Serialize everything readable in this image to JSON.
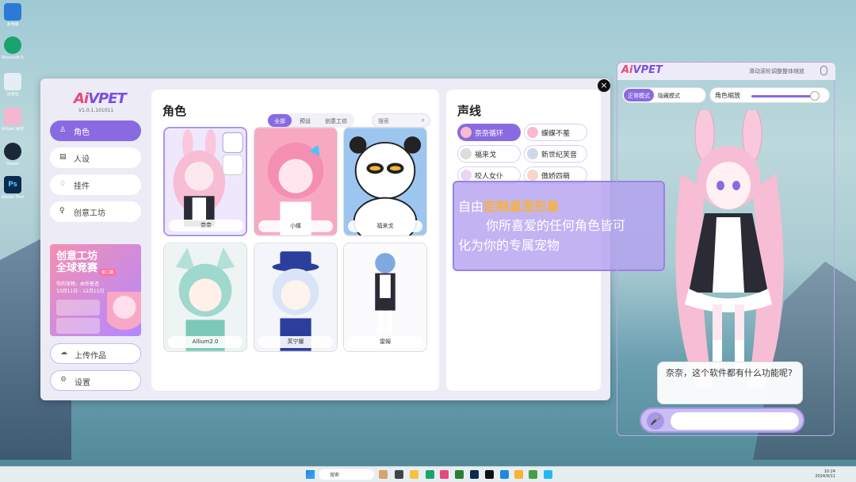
{
  "desktop": {
    "icons": [
      {
        "label": "此电脑",
        "color": "#2b7bd6"
      },
      {
        "label": "Microsoft Edge",
        "color": "#1aa36f"
      },
      {
        "label": "回收站",
        "color": "#e5eef5"
      },
      {
        "label": "AiVpet 桌宠",
        "color": "#f3b7cf"
      },
      {
        "label": "Steam",
        "color": "#1b2838"
      },
      {
        "label": "Adobe Photoshop",
        "color": "#0b2a4e"
      }
    ]
  },
  "taskbar": {
    "search_placeholder": "搜索",
    "time": "10:24",
    "date": "2024/9/11"
  },
  "main_window": {
    "logo_ai": "Ai",
    "logo_rest": "VPET",
    "version": "V1.0.1.101011",
    "close_label": "×",
    "nav": [
      {
        "label": "角色",
        "icon": "shirt-icon",
        "glyph": "♙"
      },
      {
        "label": "人设",
        "icon": "document-icon",
        "glyph": "▤"
      },
      {
        "label": "挂件",
        "icon": "gift-icon",
        "glyph": "♢"
      },
      {
        "label": "创意工坊",
        "icon": "bulb-icon",
        "glyph": "♀"
      }
    ],
    "promo": {
      "title_line1": "创意工坊",
      "title_line2": "全球竞赛",
      "tag": "第二期",
      "line1": "你的宠物，由你普造",
      "line2": "10月11日 - 12月11日"
    },
    "upload_label": "上传作品",
    "settings_label": "设置",
    "characters": {
      "title": "角色",
      "filters": [
        "全部",
        "预设",
        "创意工坊"
      ],
      "search_placeholder": "搜索",
      "cards": [
        {
          "name": "奈奈"
        },
        {
          "name": "小蝶"
        },
        {
          "name": "福来戈"
        },
        {
          "name": "Allium2.0"
        },
        {
          "name": "芙宁娜"
        },
        {
          "name": "雷姆"
        }
      ]
    },
    "voices": {
      "title": "声线",
      "items": [
        "奈奈循环",
        "蝶蝶不羞",
        "福来戈",
        "新世纪芙音",
        "咬人女仆",
        "傲娇四萌"
      ]
    }
  },
  "tooltip": {
    "prefix": "自由",
    "highlight": "定制桌宠形象",
    "line2": "你所喜爱的任何角色皆可",
    "line3": "化为你的专属宠物"
  },
  "pet_window": {
    "logo_ai": "Ai",
    "logo_rest": "VPET",
    "hint": "滑动滚轮调整整体缩放",
    "modes": [
      "正常模式",
      "隐藏模式"
    ],
    "scale_label": "角色缩放",
    "scale_value": 0.95,
    "speech": "奈奈，这个软件都有什么功能呢?",
    "chat_value": ""
  },
  "colors": {
    "accent": "#8a6ae0",
    "highlight": "#f9b233",
    "brand_pink": "#e8477a"
  }
}
